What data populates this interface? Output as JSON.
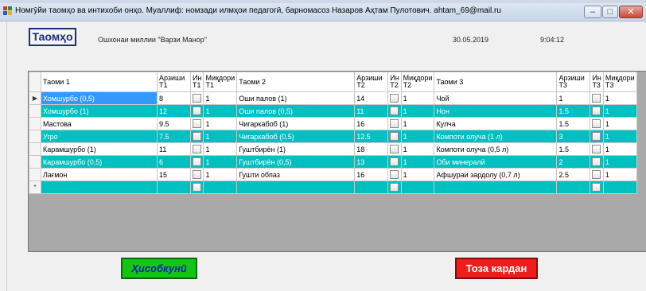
{
  "window": {
    "title": "Номгӯйи таомҳо ва интихоби онҳо.    Муаллиф: номзади илмҳои педагогӣ, барномасоз Назаров Аҳтам Пулотович. ahtam_69@mail.ru",
    "minimize": "–",
    "maximize": "□",
    "close": "✕"
  },
  "header": {
    "taomho_button": "Таомҳо",
    "restaurant": "Ошхонаи миллии \"Варзи Манор\"",
    "date": "30.05.2019",
    "time": "9:04:12"
  },
  "grid": {
    "columns": [
      "Таоми 1",
      "Арзиши Т1",
      "Ин Т1",
      "Миқдори Т1",
      "Таоми 2",
      "Арзиши Т2",
      "Ин Т2",
      "Миқдори Т2",
      "Таоми 3",
      "Арзиши Т3",
      "Ин Т3",
      "Миқдори Т3"
    ],
    "rows": [
      {
        "marker": "▶",
        "t1": "Хомшурбо  (0,5)",
        "a1": "8",
        "m1": "1",
        "t2": "Оши палов (1)",
        "a2": "14",
        "m2": "1",
        "t3": "Чой",
        "a3": "1",
        "m3": "1"
      },
      {
        "marker": "",
        "t1": "Хомшурбо  (1)",
        "a1": "12",
        "m1": "1",
        "t2": "Оши палов (0,5)",
        "a2": "11",
        "m2": "1",
        "t3": "Нон",
        "a3": "1.5",
        "m3": "1"
      },
      {
        "marker": "",
        "t1": "Мастова",
        "a1": "9.5",
        "m1": "1",
        "t2": "Чигаркабоб (1)",
        "a2": "16",
        "m2": "1",
        "t3": "Кулча",
        "a3": "1.5",
        "m3": "1"
      },
      {
        "marker": "",
        "t1": "Угро",
        "a1": "7.5",
        "m1": "1",
        "t2": "Чигаркабоб (0,5)",
        "a2": "12.5",
        "m2": "1",
        "t3": "Компоти олуча (1 л)",
        "a3": "3",
        "m3": "1"
      },
      {
        "marker": "",
        "t1": "Карамшурбо (1)",
        "a1": "11",
        "m1": "1",
        "t2": "Гуштбирён (1)",
        "a2": "18",
        "m2": "1",
        "t3": "Компоти олуча (0,5 л)",
        "a3": "1.5",
        "m3": "1"
      },
      {
        "marker": "",
        "t1": "Карамшурбо (0,5)",
        "a1": "6",
        "m1": "1",
        "t2": "Гуштбирён (0,5)",
        "a2": "13",
        "m2": "1",
        "t3": "Оби минералӣ",
        "a3": "2",
        "m3": "1"
      },
      {
        "marker": "",
        "t1": "Лағмон",
        "a1": "15",
        "m1": "1",
        "t2": "Гушти обпаз",
        "a2": "16",
        "m2": "1",
        "t3": "Афшураи зардолу (0,7 л)",
        "a3": "2.5",
        "m3": "1"
      }
    ],
    "new_row_marker": "*"
  },
  "buttons": {
    "calculate": "Ҳисобкунӣ",
    "clear": "Тоза кардан"
  },
  "colors": {
    "teal_row": "#00c0c0",
    "selection": "#3399ff",
    "calc_green": "#15c515",
    "clear_red": "#ef1c1c"
  }
}
